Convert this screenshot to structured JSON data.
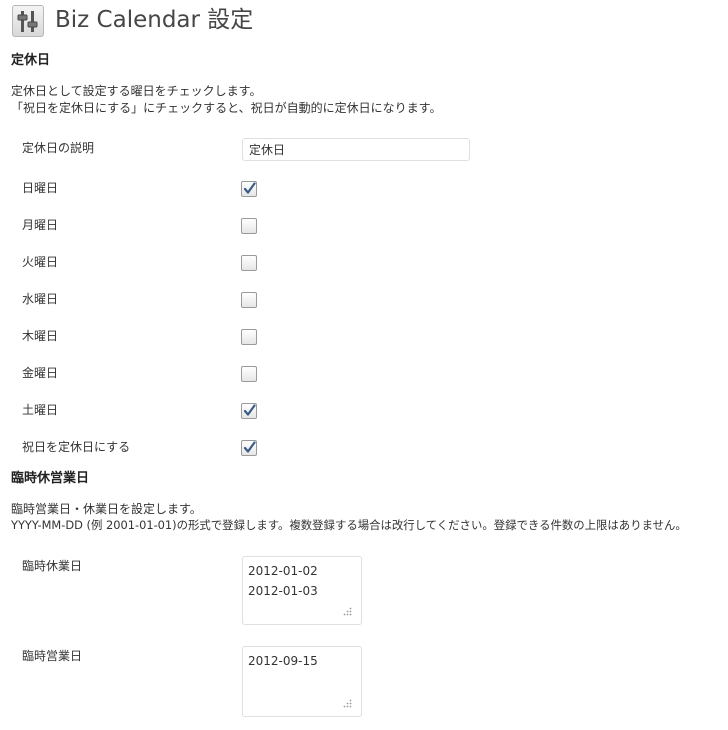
{
  "header": {
    "title": "Biz Calendar 設定",
    "icon": "settings-sliders-icon"
  },
  "holiday_section": {
    "heading": "定休日",
    "description_lines": [
      "定休日として設定する曜日をチェックします。",
      "「祝日を定休日にする」にチェックすると、祝日が自動的に定休日になります。"
    ],
    "explanation_label": "定休日の説明",
    "explanation_value": "定休日",
    "days": [
      {
        "label": "日曜日",
        "checked": true
      },
      {
        "label": "月曜日",
        "checked": false
      },
      {
        "label": "火曜日",
        "checked": false
      },
      {
        "label": "水曜日",
        "checked": false
      },
      {
        "label": "木曜日",
        "checked": false
      },
      {
        "label": "金曜日",
        "checked": false
      },
      {
        "label": "土曜日",
        "checked": true
      },
      {
        "label": "祝日を定休日にする",
        "checked": true
      }
    ]
  },
  "temporary_section": {
    "heading": "臨時休営業日",
    "description_lines": [
      "臨時営業日・休業日を設定します。",
      "YYYY-MM-DD (例 2001-01-01)の形式で登録します。複数登録する場合は改行してください。登録できる件数の上限はありません。"
    ],
    "closed_days": {
      "label": "臨時休業日",
      "values": [
        "2012-01-02",
        "2012-01-03"
      ]
    },
    "open_days": {
      "label": "臨時営業日",
      "values": [
        "2012-09-15"
      ]
    }
  },
  "colors": {
    "check_mark": "#3a5b86",
    "title_text": "#464646"
  }
}
